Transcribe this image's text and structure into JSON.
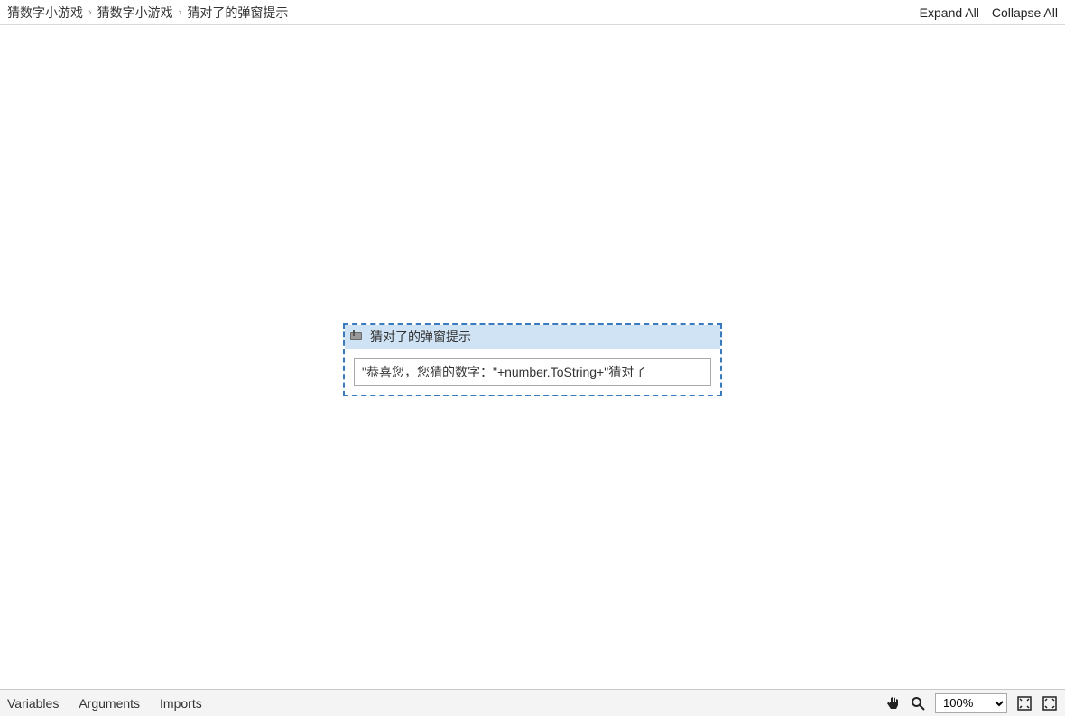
{
  "breadcrumb": {
    "items": [
      "猜数字小游戏",
      "猜数字小游戏",
      "猜对了的弹窗提示"
    ]
  },
  "topActions": {
    "expandAll": "Expand All",
    "collapseAll": "Collapse All"
  },
  "activity": {
    "title": "猜对了的弹窗提示",
    "expression": "\"恭喜您，您猜的数字：\"+number.ToString+\"猜对了"
  },
  "bottom": {
    "tabs": {
      "variables": "Variables",
      "arguments": "Arguments",
      "imports": "Imports"
    },
    "zoom": "100%"
  }
}
